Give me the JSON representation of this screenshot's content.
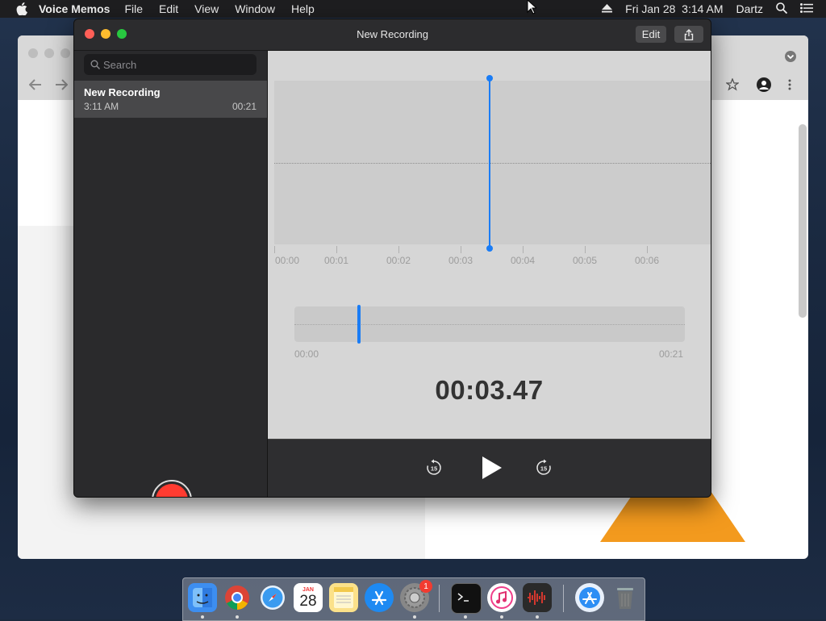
{
  "menubar": {
    "app_name": "Voice Memos",
    "menus": [
      "File",
      "Edit",
      "View",
      "Window",
      "Help"
    ],
    "datetime": "Fri Jan 28  3:14 AM",
    "user": "Dartz"
  },
  "window": {
    "title": "New Recording",
    "edit_label": "Edit"
  },
  "sidebar": {
    "search_placeholder": "Search",
    "recordings": [
      {
        "name": "New Recording",
        "time": "3:11 AM",
        "duration": "00:21"
      }
    ]
  },
  "waveform": {
    "ruler_labels": [
      "00:00",
      "00:01",
      "00:02",
      "00:03",
      "00:04",
      "00:05",
      "00:06"
    ],
    "playhead_seconds": 3.47
  },
  "overview": {
    "start": "00:00",
    "end": "00:21",
    "position_fraction": 0.165
  },
  "player": {
    "current_time": "00:03.47",
    "skip_seconds": "15"
  },
  "dock": {
    "calendar_month": "JAN",
    "calendar_day": "28",
    "prefs_badge": "1"
  },
  "colors": {
    "accent": "#1a7cf5",
    "record": "#ff3b30"
  }
}
